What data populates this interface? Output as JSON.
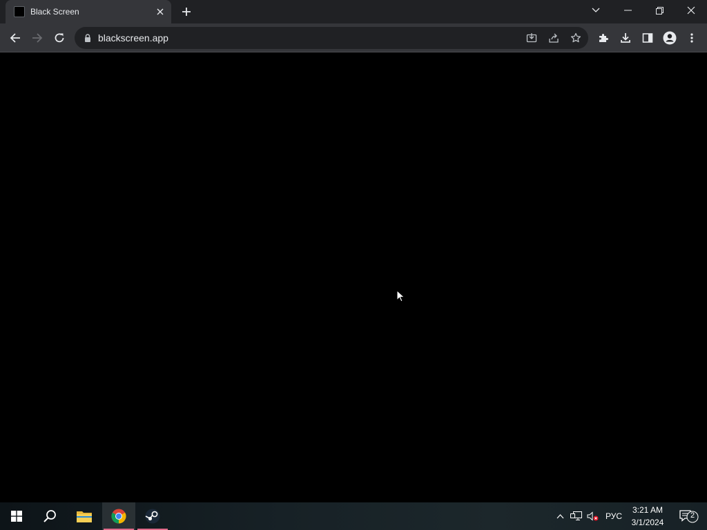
{
  "browser": {
    "tab": {
      "title": "Black Screen"
    },
    "address_bar": {
      "url": "blackscreen.app"
    }
  },
  "taskbar": {
    "apps": [
      {
        "name": "start",
        "icon": "windows-logo-icon"
      },
      {
        "name": "search",
        "icon": "search-icon"
      },
      {
        "name": "file-explorer",
        "icon": "folder-icon"
      },
      {
        "name": "chrome",
        "icon": "chrome-icon",
        "active": true
      },
      {
        "name": "steam",
        "icon": "steam-icon",
        "running": true
      }
    ],
    "tray": {
      "language": "РУС",
      "time": "3:21 AM",
      "date": "3/1/2024",
      "notifications": "2"
    }
  },
  "colors": {
    "chrome_dark": "#202124",
    "toolbar": "#35363a",
    "text": "#e8eaed",
    "page_background": "#000000",
    "running_indicator": "#e06a8a"
  }
}
